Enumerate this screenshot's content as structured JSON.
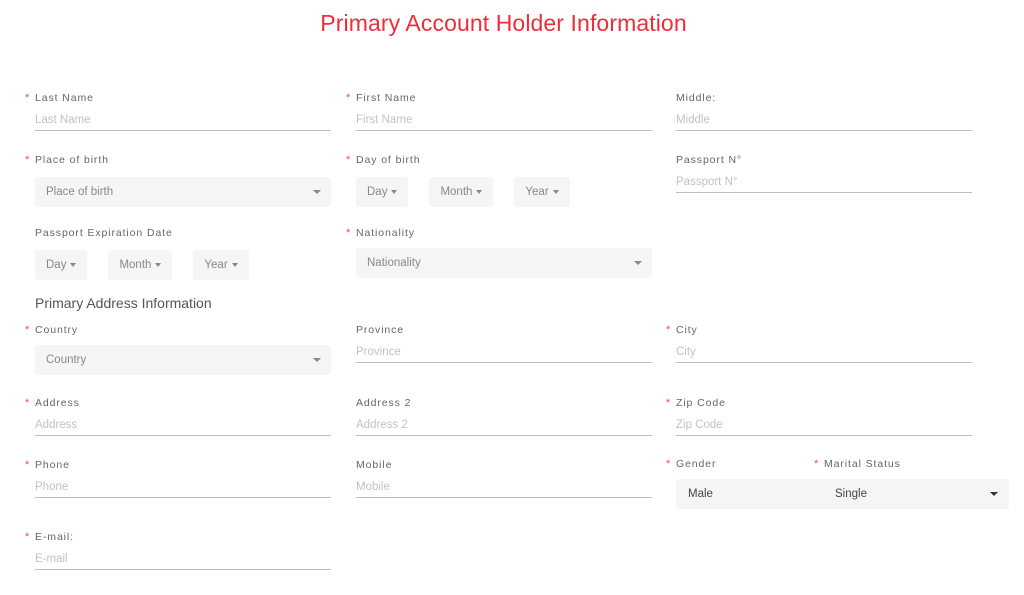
{
  "page": {
    "title": "Primary Account Holder Information",
    "accent_color": "#ef2d3a",
    "required_marker": "*"
  },
  "personal": {
    "last_name": {
      "label": "Last Name",
      "placeholder": "Last Name",
      "value": "",
      "required": true
    },
    "first_name": {
      "label": "First Name",
      "placeholder": "First Name",
      "value": "",
      "required": true
    },
    "middle": {
      "label": "Middle:",
      "placeholder": "Middle",
      "value": "",
      "required": false
    },
    "place_of_birth": {
      "label": "Place of birth",
      "selected": "Place of birth",
      "required": true
    },
    "day_of_birth": {
      "label": "Day of birth",
      "day": "Day",
      "month": "Month",
      "year": "Year",
      "required": true
    },
    "passport_no": {
      "label": "Passport N°",
      "placeholder": "Passport N°",
      "value": "",
      "required": false
    },
    "passport_expiration": {
      "label": "Passport Expiration Date",
      "day": "Day",
      "month": "Month",
      "year": "Year",
      "required": false
    },
    "nationality": {
      "label": "Nationality",
      "selected": "Nationality",
      "required": true
    }
  },
  "address_section": {
    "heading": "Primary Address Information",
    "country": {
      "label": "Country",
      "selected": "Country",
      "required": true
    },
    "province": {
      "label": "Province",
      "placeholder": "Province",
      "value": "",
      "required": false
    },
    "city": {
      "label": "City",
      "placeholder": "City",
      "value": "",
      "required": true
    },
    "address": {
      "label": "Address",
      "placeholder": "Address",
      "value": "",
      "required": true
    },
    "address2": {
      "label": "Address 2",
      "placeholder": "Address 2",
      "value": "",
      "required": false
    },
    "zip": {
      "label": "Zip Code",
      "placeholder": "Zip Code",
      "value": "",
      "required": true
    },
    "phone": {
      "label": "Phone",
      "placeholder": "Phone",
      "value": "",
      "required": true
    },
    "mobile": {
      "label": "Mobile",
      "placeholder": "Mobile",
      "value": "",
      "required": false
    },
    "gender": {
      "label": "Gender",
      "selected": "Male",
      "required": true
    },
    "marital_status": {
      "label": "Marital Status",
      "selected": "Single",
      "required": true
    },
    "email": {
      "label": "E-mail:",
      "placeholder": "E-mail",
      "value": "",
      "required": true
    }
  }
}
